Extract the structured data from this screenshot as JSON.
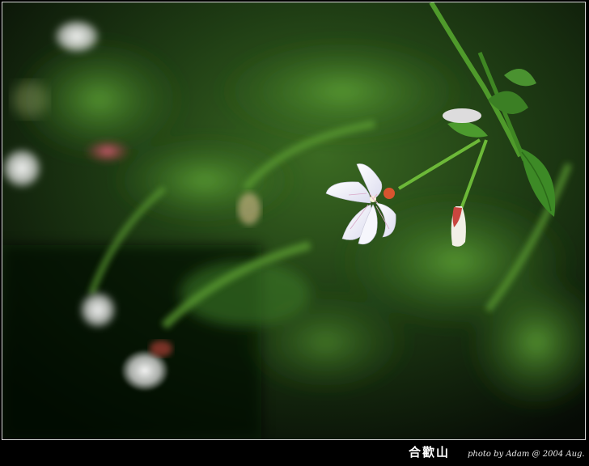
{
  "image": {
    "description_subject": "white wildflower on green stem",
    "colors": {
      "background_dark": "#0c140a",
      "foliage": "#2f6a22",
      "foliage_light": "#7bbf46",
      "petal": "#f4f4fb",
      "bud_red": "#c9463f",
      "frame_border": "#d8d8d8"
    }
  },
  "caption": {
    "title": "合歡山",
    "credit": "photo by Adam @ 2004 Aug."
  }
}
